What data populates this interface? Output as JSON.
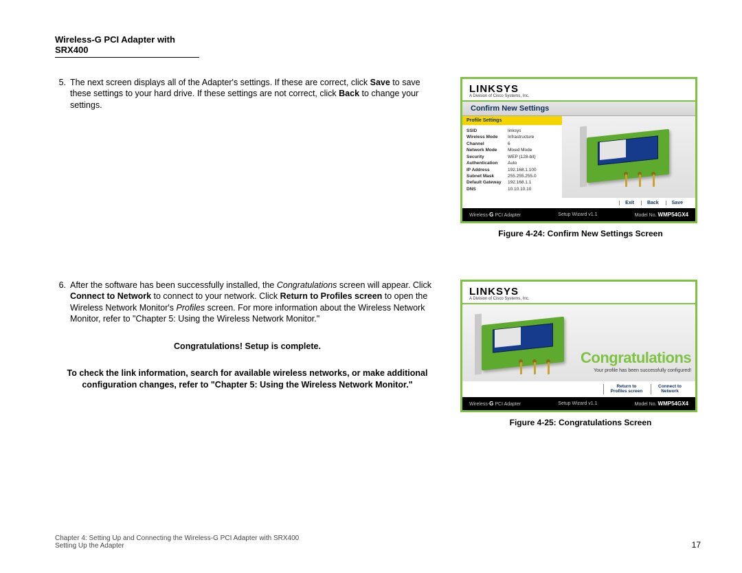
{
  "header": "Wireless-G PCI Adapter with SRX400",
  "step5": {
    "num": "5.",
    "t1": "The next screen displays all of the Adapter's settings. If these are correct, click ",
    "b1": "Save",
    "t2": " to save these settings to your hard drive. If these settings are not correct, click ",
    "b2": "Back",
    "t3": " to change your settings."
  },
  "step6": {
    "num": "6.",
    "t1": "After the software has been successfully installed, the ",
    "i1": "Congratulations",
    "t2": " screen will appear. Click ",
    "b1": "Connect to Network",
    "t3": " to connect to your network. Click ",
    "b2": "Return to Profiles screen",
    "t4": " to open the Wireless Network Monitor's ",
    "i2": "Profiles",
    "t5": " screen. For more information about the Wireless Network Monitor, refer to \"Chapter 5: Using the Wireless Network Monitor.\""
  },
  "congrats_line": "Congratulations! Setup is complete.",
  "note_line": "To check the link information, search for available wireless networks, or make additional configuration changes, refer to \"Chapter 5: Using the Wireless Network Monitor.\"",
  "fig24_caption": "Figure 4-24: Confirm New Settings Screen",
  "fig25_caption": "Figure 4-25: Congratulations Screen",
  "brand": "LINKSYS",
  "brand_sub": "A Division of Cisco Systems, Inc.",
  "dlg24": {
    "title": "Confirm New Settings",
    "section": "Profile Settings",
    "rows": [
      {
        "k": "SSID",
        "v": "linksys"
      },
      {
        "k": "Wireless Mode",
        "v": "Infrastructure"
      },
      {
        "k": "Channel",
        "v": "6"
      },
      {
        "k": "Network Mode",
        "v": "Mixed Mode"
      },
      {
        "k": "Security",
        "v": "WEP (128-bit)"
      },
      {
        "k": "Authentication",
        "v": "Auto"
      },
      {
        "k": "IP Address",
        "v": "192.168.1.100"
      },
      {
        "k": "Subnet Mask",
        "v": "255.255.255.0"
      },
      {
        "k": "Default Gateway",
        "v": "192.168.1.1"
      },
      {
        "k": "DNS",
        "v": "10.10.10.10"
      }
    ],
    "btns": {
      "b1": "Exit",
      "b2": "Back",
      "b3": "Save"
    }
  },
  "dlg25": {
    "title": "Congratulations",
    "sub": "Your profile has been successfully configured!",
    "btns": {
      "b1a": "Return to",
      "b1b": "Profiles screen",
      "b2a": "Connect to",
      "b2b": "Network"
    }
  },
  "dlg_footer": {
    "prod_a": "Wireless-",
    "prod_b": "G",
    "prod_c": " PCI Adapter",
    "mid": "Setup Wizard  v1.1",
    "model_a": "Model No.",
    "model_b": "WMP54GX4"
  },
  "footer": {
    "line1": "Chapter 4: Setting Up and Connecting the Wireless-G PCI Adapter with SRX400",
    "line2": "Setting Up the Adapter",
    "pagenum": "17"
  }
}
